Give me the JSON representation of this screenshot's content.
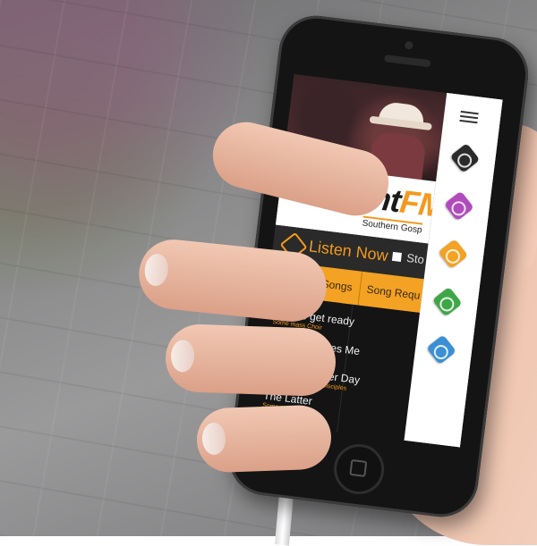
{
  "app": {
    "logo_prefix": "Light",
    "logo_accent": "FM",
    "logo_subtitle": "Southern Gosp"
  },
  "player": {
    "listen_label": "Listen Now",
    "stop_label": "Sto"
  },
  "tabs": [
    {
      "label": "Recent Songs"
    },
    {
      "label": "Song Requ"
    }
  ],
  "songs": [
    {
      "title": "People get ready",
      "artist": "Some mass Choir"
    },
    {
      "title": "God Still Loves Me",
      "artist": "Andrae Crouch"
    },
    {
      "title": "This Is Another Day",
      "artist": "Andrae Crouch/The Disciples"
    },
    {
      "title": "The Latter",
      "artist": "Some mass Choir"
    }
  ],
  "side_menu": {
    "buttons": [
      {
        "icon": "radio-icon",
        "color": "#2b2b2b"
      },
      {
        "icon": "music-icon",
        "color": "#b14bbd"
      },
      {
        "icon": "mic-icon",
        "color": "#f3a223"
      },
      {
        "icon": "prayer-icon",
        "color": "#3fa648"
      },
      {
        "icon": "info-icon",
        "color": "#3b8fd3"
      }
    ]
  },
  "colors": {
    "accent": "#f39a1e",
    "tab_bar": "#f3a223"
  }
}
